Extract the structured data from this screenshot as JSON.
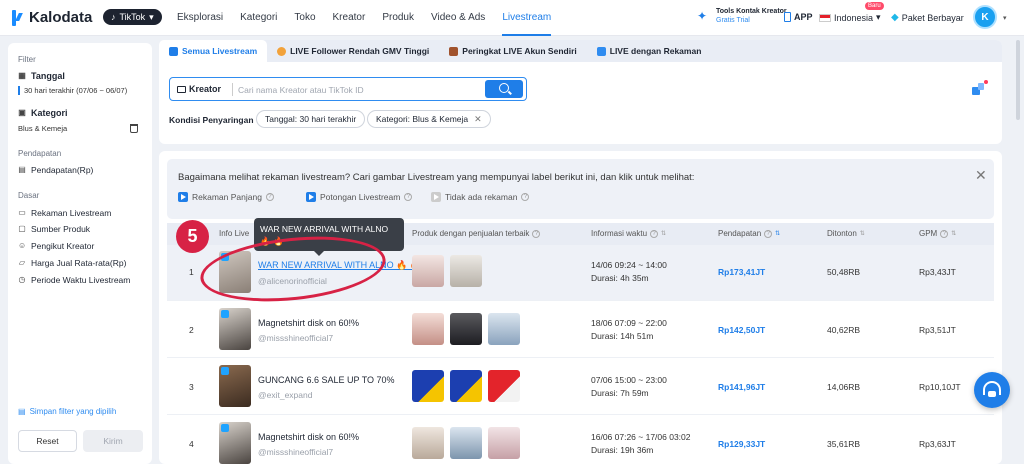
{
  "brand": {
    "name": "Kalodata",
    "platform": "TikTok"
  },
  "nav": [
    "Eksplorasi",
    "Kategori",
    "Toko",
    "Kreator",
    "Produk",
    "Video & Ads",
    "Livestream"
  ],
  "header": {
    "tools_title": "Tools Kontak Kreator",
    "tools_sub": "Gratis Trial",
    "app": "APP",
    "language": "Indonesia",
    "baru": "Baru",
    "plan": "Paket Berbayar",
    "avatar": "K"
  },
  "sidebar": {
    "filter_label": "Filter",
    "tanggal_label": "Tanggal",
    "tanggal_value": "30 hari terakhir (07/06 ~ 06/07)",
    "kategori_label": "Kategori",
    "kategori_value": "Blus & Kemeja",
    "pendapatan_section": "Pendapatan",
    "pendapatan_item": "Pendapatan(Rp)",
    "dasar_section": "Dasar",
    "dasar_items": [
      "Rekaman Livestream",
      "Sumber Produk",
      "Pengikut Kreator",
      "Harga Jual Rata-rata(Rp)",
      "Periode Waktu Livestream"
    ],
    "save_filter": "Simpan filter yang dipilih",
    "reset": "Reset",
    "kirim": "Kirim"
  },
  "tabs": [
    "Semua Livestream",
    "LIVE Follower Rendah GMV Tinggi",
    "Peringkat LIVE Akun Sendiri",
    "LIVE dengan Rekaman"
  ],
  "search": {
    "prefix": "Kreator",
    "placeholder": "Cari nama Kreator atau TikTok ID"
  },
  "conditions": {
    "label": "Kondisi Penyaringan",
    "chips": [
      "Tanggal: 30 hari terakhir",
      "Kategori: Blus & Kemeja"
    ]
  },
  "info": {
    "text": "Bagaimana melihat rekaman livestream? Cari gambar Livestream yang mempunyai label berikut ini, dan klik untuk melihat:",
    "legend": [
      "Rekaman Panjang",
      "Potongan Livestream",
      "Tidak ada rekaman"
    ]
  },
  "table": {
    "headers": [
      "Info Live",
      "Produk dengan penjualan terbaik",
      "Informasi waktu",
      "Pendapatan",
      "Ditonton",
      "GPM"
    ],
    "rows": [
      {
        "rank": "1",
        "title": "WAR NEW ARRIVAL WITH ALNO 🔥 🔥",
        "account": "@alicenorinofficial",
        "time": "14/06 09:24 ~ 14:00",
        "duration": "Durasi: 4h 35m",
        "revenue": "Rp173,41JT",
        "views": "50,48RB",
        "gpm": "Rp3,43JT"
      },
      {
        "rank": "2",
        "title": "Magnetshirt disk on 60!%",
        "account": "@missshineofficial7",
        "time": "18/06 07:09 ~ 22:00",
        "duration": "Durasi: 14h 51m",
        "revenue": "Rp142,50JT",
        "views": "40,62RB",
        "gpm": "Rp3,51JT"
      },
      {
        "rank": "3",
        "title": "GUNCANG 6.6 SALE UP TO 70%",
        "account": "@exit_expand",
        "time": "07/06 15:00 ~ 23:00",
        "duration": "Durasi: 7h 59m",
        "revenue": "Rp141,96JT",
        "views": "14,06RB",
        "gpm": "Rp10,10JT"
      },
      {
        "rank": "4",
        "title": "Magnetshirt disk on 60!%",
        "account": "@missshineofficial7",
        "time": "16/06 07:26 ~ 17/06 03:02",
        "duration": "Durasi: 19h 36m",
        "revenue": "Rp129,33JT",
        "views": "35,61RB",
        "gpm": "Rp3,63JT"
      }
    ]
  },
  "tooltip": "WAR NEW ARRIVAL WITH ALNO 🔥 🔥",
  "annotation": {
    "step": "5"
  },
  "colors": {
    "accent": "#1f7ee8",
    "annotation": "#d72245",
    "dark": "#1d2330"
  }
}
